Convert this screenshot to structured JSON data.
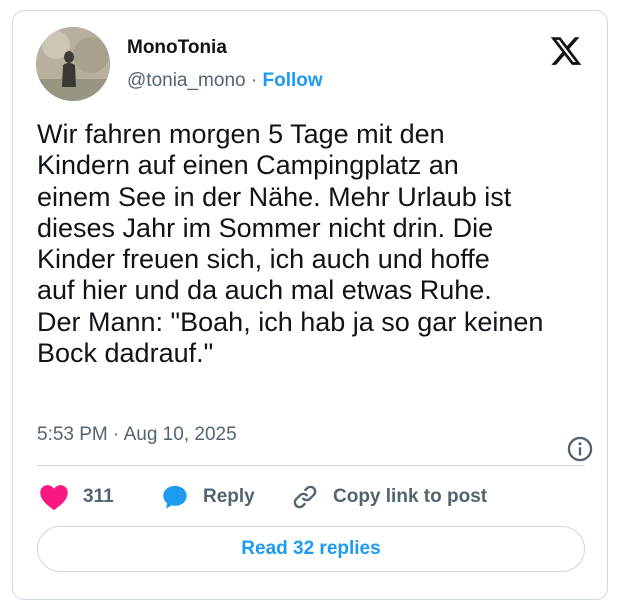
{
  "author": {
    "name": "MonoTonia",
    "handle": "@tonia_mono",
    "separator": " · ",
    "follow_label": "Follow"
  },
  "tweet": {
    "text": "Wir fahren morgen 5 Tage mit den\nKindern auf einen Campingplatz an\neinem See in der Nähe. Mehr Urlaub ist\ndieses Jahr im Sommer nicht drin. Die\nKinder freuen sich, ich auch und hoffe\nauf hier und da auch mal etwas Ruhe.\nDer Mann: \"Boah, ich hab ja so gar keinen\nBock dadrauf.\"",
    "timestamp": "5:53 PM · Aug 10, 2025"
  },
  "actions": {
    "like_count": "311",
    "reply_label": "Reply",
    "copy_label": "Copy link to post"
  },
  "read_replies_label": "Read 32 replies",
  "icons": {
    "logo": "x-logo-icon",
    "info": "info-icon",
    "like": "heart-icon",
    "reply": "speech-bubble-icon",
    "copy": "link-icon"
  },
  "colors": {
    "accent": "#1d9bf0",
    "like": "#f91880",
    "text": "#0f1419",
    "secondary": "#536471",
    "border": "#cfd9de"
  }
}
